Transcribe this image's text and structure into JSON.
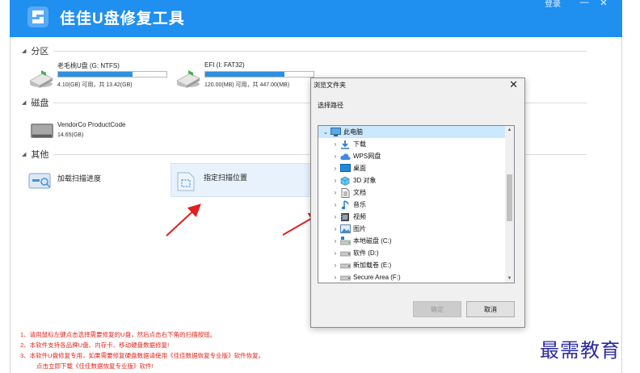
{
  "app": {
    "title": "佳佳U盘修复工具",
    "login": "登录",
    "minimize": "—",
    "close": "✕",
    "brand_color": "#1f8ff0"
  },
  "sections": {
    "partition": "分区",
    "disk": "磁盘",
    "other": "其他"
  },
  "partitions": [
    {
      "name": "老毛桃U盘 (G: NTFS)",
      "info": "4.10(GB) 可用，共 13.42(GB)",
      "used_fraction": 0.69,
      "icon": "usb-drive-icon"
    },
    {
      "name": "EFI (I: FAT32)",
      "info": "120.00(MB) 可用，共 447.00(MB)",
      "used_fraction": 0.73,
      "icon": "usb-drive-icon"
    }
  ],
  "disks": [
    {
      "name": "VendorCo ProductCode",
      "info": "14.65(GB)",
      "icon": "disk-icon"
    }
  ],
  "other": {
    "load_scan": "加载扫描进度",
    "scan_location": "指定扫描位置"
  },
  "notes": [
    "1、请用鼠标左键点击选择需要修复的U盘，然后点击右下角的扫描按钮。",
    "2、本软件支持各品牌U盘、内存卡、移动硬盘数据修复!",
    "3、本软件U盘修复专用，如果需要修复硬盘数据请使用《佳佳数据恢复专业版》软件恢复。",
    "点击立即下载《佳佳数据恢复专业版》软件!"
  ],
  "dialog": {
    "title": "浏览文件夹",
    "close": "✕",
    "subtitle": "选择路径",
    "tree": [
      {
        "label": "此电脑",
        "icon": "computer-icon",
        "expanded": true,
        "level": 0,
        "selected": true
      },
      {
        "label": "下载",
        "icon": "download-icon",
        "level": 1
      },
      {
        "label": "WPS网盘",
        "icon": "cloud-icon",
        "level": 1
      },
      {
        "label": "桌面",
        "icon": "desktop-icon",
        "level": 1
      },
      {
        "label": "3D 对象",
        "icon": "3d-objects-icon",
        "level": 1
      },
      {
        "label": "文档",
        "icon": "document-icon",
        "level": 1
      },
      {
        "label": "音乐",
        "icon": "music-icon",
        "level": 1
      },
      {
        "label": "视频",
        "icon": "video-icon",
        "level": 1
      },
      {
        "label": "图片",
        "icon": "picture-icon",
        "level": 1
      },
      {
        "label": "本地磁盘 (C:)",
        "icon": "local-disk-icon",
        "level": 1
      },
      {
        "label": "软件 (D:)",
        "icon": "drive-icon",
        "level": 1
      },
      {
        "label": "新加载卷 (E:)",
        "icon": "drive-icon",
        "level": 1
      },
      {
        "label": "Secure Area (F:)",
        "icon": "drive-icon",
        "level": 1
      }
    ],
    "ok": "确定",
    "cancel": "取消"
  },
  "watermark": "最需教育",
  "accent_arrow_color": "#e02020"
}
